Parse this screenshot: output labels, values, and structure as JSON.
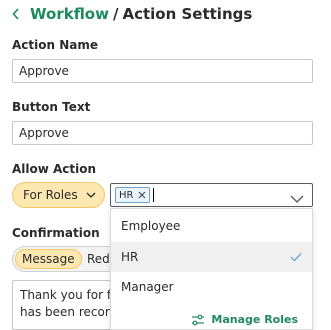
{
  "breadcrumb": {
    "parent": "Workflow",
    "separator": "/",
    "current": "Action Settings"
  },
  "action_name": {
    "label": "Action Name",
    "value": "Approve"
  },
  "button_text": {
    "label": "Button Text",
    "value": "Approve"
  },
  "allow_action": {
    "label": "Allow Action",
    "mode": "For Roles",
    "selected_roles": [
      "HR"
    ],
    "options": [
      "Employee",
      "HR",
      "Manager"
    ],
    "manage_roles": "Manage Roles"
  },
  "confirmation": {
    "label": "Confirmation",
    "tabs": [
      "Message",
      "Redi"
    ],
    "message_lines": [
      "Thank you for fil",
      "has been record"
    ]
  },
  "colors": {
    "accent": "#1f8a5e",
    "pill_bg": "#fce8b0",
    "pill_border": "#f3c86a"
  }
}
